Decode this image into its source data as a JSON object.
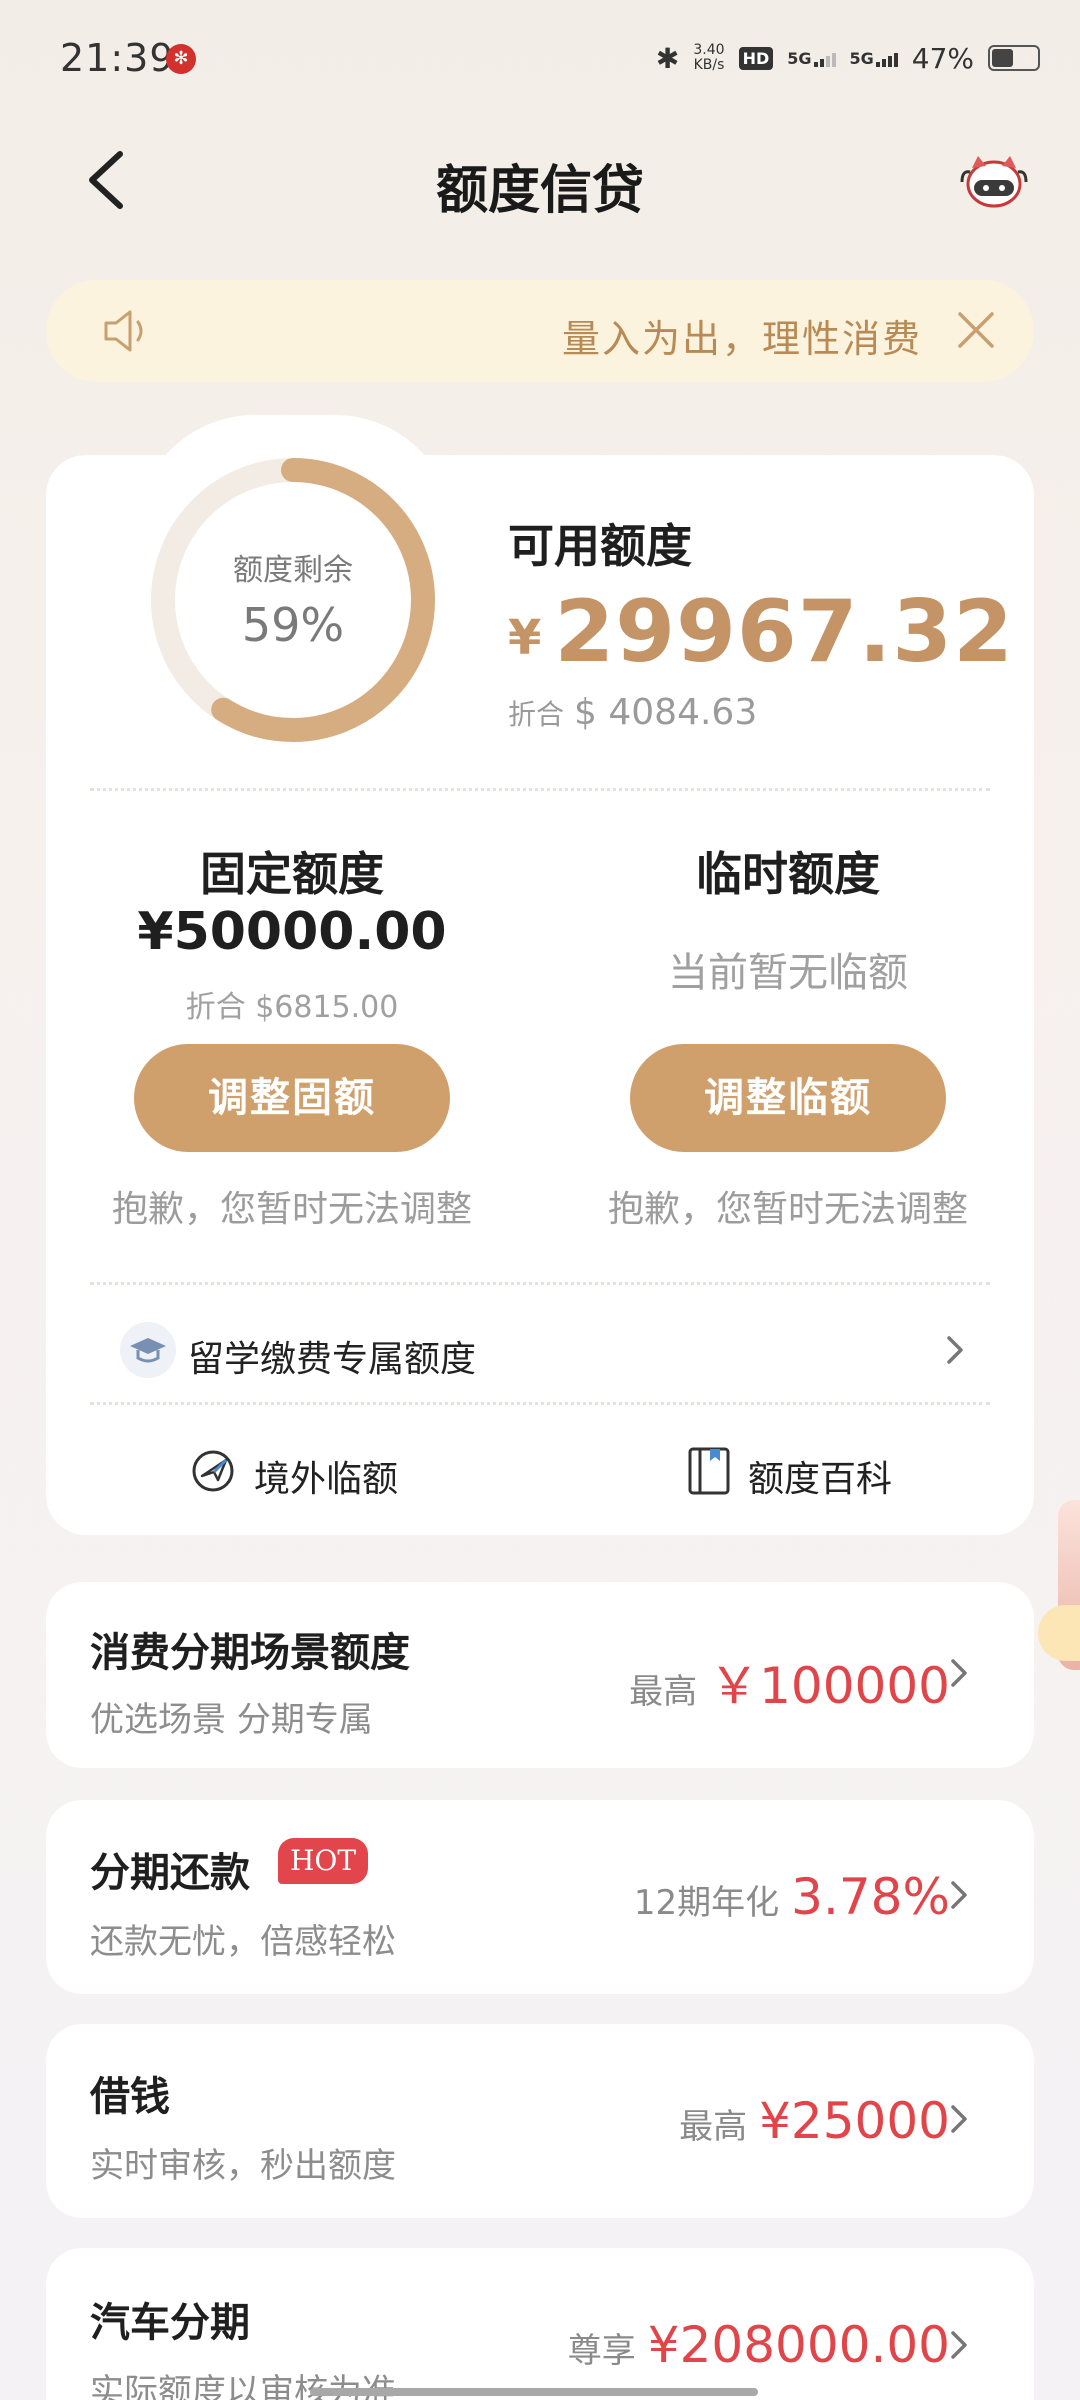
{
  "status_bar": {
    "time": "21:39",
    "net_speed_value": "3.40",
    "net_speed_unit": "KB/s",
    "hd": "HD",
    "network_1": "5G",
    "network_2": "5G",
    "battery": "47%",
    "battery_level": 0.47
  },
  "header": {
    "title": "额度信贷"
  },
  "notice": {
    "text": "量入为出，理性消费"
  },
  "credit": {
    "ring_label": "额度剩余",
    "ring_value": "59%",
    "ring_fraction": 0.59,
    "available_title": "可用额度",
    "available_currency": "¥",
    "available_amount": "29967.32",
    "conversion_prefix": "折合",
    "conversion_value": "$ 4084.63"
  },
  "fixed_limit": {
    "title": "固定额度",
    "amount": "¥50000.00",
    "conversion": "折合 $6815.00",
    "button": "调整固额",
    "note": "抱歉，您暂时无法调整"
  },
  "temp_limit": {
    "title": "临时额度",
    "status": "当前暂无临额",
    "button": "调整临额",
    "note": "抱歉，您暂时无法调整"
  },
  "study_abroad": {
    "label": "留学缴费专属额度"
  },
  "quick_links": {
    "overseas": "境外临额",
    "wiki": "额度百科"
  },
  "products": [
    {
      "title": "消费分期场景额度",
      "subtitle": "优选场景 分期专属",
      "label": "最高",
      "value": "￥100000"
    },
    {
      "title": "分期还款",
      "badge": "HOT",
      "subtitle": "还款无忧，倍感轻松",
      "label": "12期年化",
      "value": "3.78%"
    },
    {
      "title": "借钱",
      "subtitle": "实时审核，秒出额度",
      "label": "最高",
      "value": "¥25000"
    },
    {
      "title": "汽车分期",
      "subtitle": "实际额度以审核为准",
      "label": "尊享",
      "value": "¥208000.00"
    }
  ],
  "colors": {
    "gold": "#cfa06c",
    "amount_gold": "#c49466",
    "red": "#e0454a"
  }
}
